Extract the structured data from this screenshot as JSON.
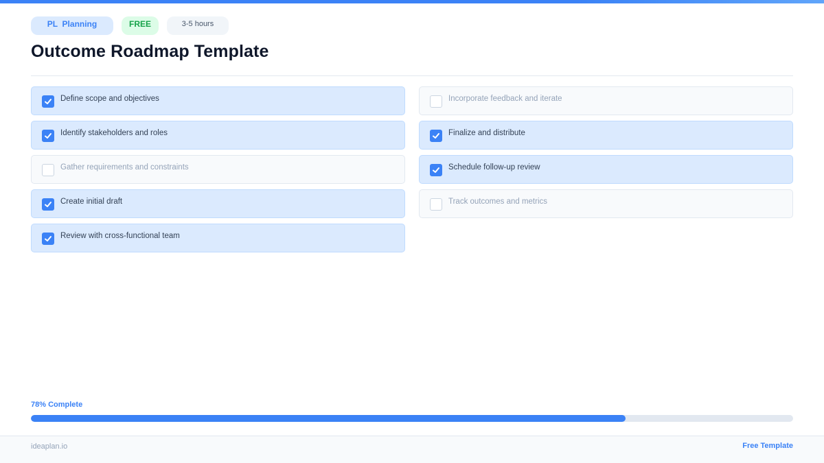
{
  "colors": {
    "accent": "#3b82f6",
    "done_bg": "#dbeafe",
    "free_green": "#16a34a"
  },
  "badges": {
    "category": "PL  Planning",
    "price": "FREE",
    "duration": "3-5 hours"
  },
  "title": "Outcome Roadmap Template",
  "tasks_left": [
    {
      "label": "Define scope and objectives",
      "done": true
    },
    {
      "label": "Identify stakeholders and roles",
      "done": true
    },
    {
      "label": "Gather requirements and constraints",
      "done": false
    },
    {
      "label": "Create initial draft",
      "done": true
    },
    {
      "label": "Review with cross-functional team",
      "done": true
    }
  ],
  "tasks_right": [
    {
      "label": "Incorporate feedback and iterate",
      "done": false
    },
    {
      "label": "Finalize and distribute",
      "done": true
    },
    {
      "label": "Schedule follow-up review",
      "done": true
    },
    {
      "label": "Track outcomes and metrics",
      "done": false
    }
  ],
  "progress": {
    "label": "78% Complete",
    "percent": 78
  },
  "footer": {
    "site": "ideaplan.io",
    "cta": "Free Template"
  }
}
